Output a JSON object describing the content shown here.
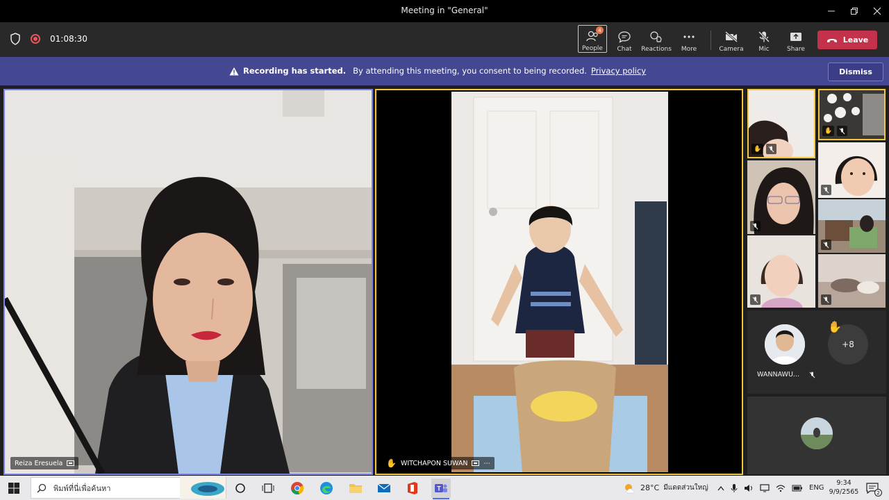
{
  "window": {
    "title": "Meeting in \"General\""
  },
  "toolbar": {
    "timer": "01:08:30",
    "people_label": "People",
    "people_badge": "4",
    "chat_label": "Chat",
    "reactions_label": "Reactions",
    "more_label": "More",
    "camera_label": "Camera",
    "mic_label": "Mic",
    "share_label": "Share",
    "leave_label": "Leave"
  },
  "banner": {
    "title": "Recording has started.",
    "message": "By attending this meeting, you consent to being recorded.",
    "link": "Privacy policy",
    "dismiss_label": "Dismiss"
  },
  "participants": {
    "main_left": {
      "name": "Reiza Eresuela"
    },
    "main_center": {
      "name": "WITCHAPON SUWAN",
      "more": "⋯"
    },
    "avatar_1": {
      "name": "WANNAWU..."
    },
    "overflow": {
      "count": "+8"
    }
  },
  "taskbar": {
    "search_placeholder": "พิมพ์ที่นี่เพื่อค้นหา",
    "weather_temp": "28°C",
    "weather_text": "มีแดดส่วนใหญ่",
    "language": "ENG",
    "time": "9:34",
    "date": "9/9/2565",
    "notification_count": "2"
  },
  "colors": {
    "accent": "#444791",
    "leave": "#c4314b",
    "speaker_border": "#f2c744",
    "pinned_border": "#7b83eb"
  }
}
